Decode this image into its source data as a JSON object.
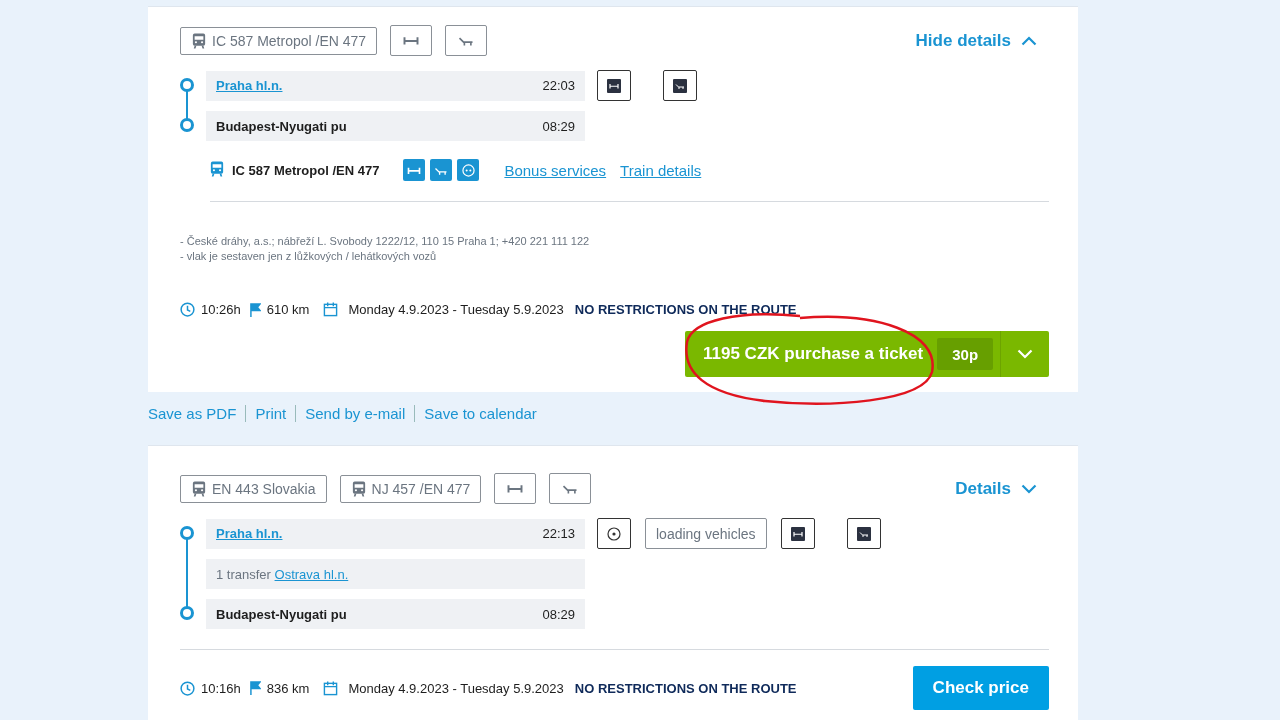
{
  "journeys": [
    {
      "tags": [
        {
          "kind": "train",
          "label": "IC 587 Metropol /EN 477"
        },
        {
          "kind": "bed"
        },
        {
          "kind": "couchette"
        }
      ],
      "toggle": {
        "label": "Hide details",
        "expanded": true
      },
      "stops": [
        {
          "kind": "station",
          "name": "Praha hl.n.",
          "link": true,
          "time": "22:03"
        },
        {
          "kind": "station",
          "name": "Budapest-Nyugati pu",
          "link": false,
          "time": "08:29"
        }
      ],
      "features": [
        {
          "kind": "bed"
        },
        {
          "kind": "couchette"
        }
      ],
      "detail": {
        "train": "IC 587 Metropol /EN 477",
        "services": [
          {
            "kind": "bed"
          },
          {
            "kind": "couchette"
          },
          {
            "kind": "socket"
          }
        ],
        "links": [
          "Bonus services",
          "Train details"
        ]
      },
      "notes": [
        "- České dráhy, a.s.; nábřeží L. Svobody 1222/12, 110 15 Praha 1; +420 221 111 122",
        "- vlak je sestaven jen z lůžkových / lehátkových vozů"
      ],
      "summary": {
        "duration": "10:26h",
        "distance": "610 km",
        "dates": "Monday 4.9.2023 - Tuesday 5.9.2023",
        "restriction": "NO RESTRICTIONS ON THE ROUTE"
      },
      "action": {
        "kind": "purchase",
        "label": "1195 CZK purchase a ticket",
        "badge": "30p"
      }
    },
    {
      "tags": [
        {
          "kind": "train",
          "label": "EN 443 Slovakia"
        },
        {
          "kind": "train",
          "label": "NJ 457 /EN 477"
        },
        {
          "kind": "bed"
        },
        {
          "kind": "couchette"
        }
      ],
      "toggle": {
        "label": "Details",
        "expanded": false
      },
      "stops": [
        {
          "kind": "station",
          "name": "Praha hl.n.",
          "link": true,
          "time": "22:13"
        },
        {
          "kind": "transfer",
          "label": "1 transfer",
          "name": "Ostrava hl.n."
        },
        {
          "kind": "station",
          "name": "Budapest-Nyugati pu",
          "link": false,
          "time": "08:29"
        }
      ],
      "features": [
        {
          "kind": "socket"
        },
        {
          "kind": "text",
          "label": "loading vehicles"
        },
        {
          "kind": "bed"
        },
        {
          "kind": "couchette"
        }
      ],
      "summary": {
        "duration": "10:16h",
        "distance": "836 km",
        "dates": "Monday 4.9.2023 - Tuesday 5.9.2023",
        "restriction": "NO RESTRICTIONS ON THE ROUTE"
      },
      "action": {
        "kind": "check",
        "label": "Check price"
      }
    }
  ],
  "page_links": [
    "Save as PDF",
    "Print",
    "Send by e-mail",
    "Save to calendar"
  ]
}
